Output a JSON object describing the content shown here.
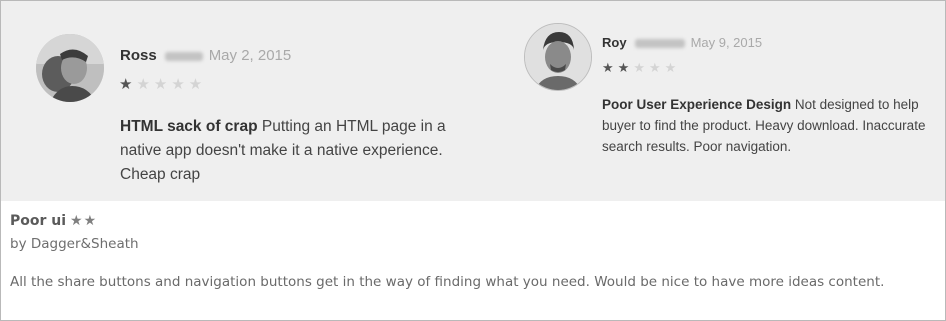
{
  "reviews": [
    {
      "author": "Ross",
      "date": "May 2, 2015",
      "rating": 1,
      "stars_filled": "★",
      "stars_empty": "★★★★",
      "title": "HTML sack of crap",
      "body": "Putting an HTML page in a native app doesn't make it a native experience. Cheap crap"
    },
    {
      "author": "Roy",
      "date": "May 9, 2015",
      "rating": 2,
      "stars_filled": "★★",
      "stars_empty": "★★★",
      "title": "Poor User Experience Design",
      "body": "Not designed to help buyer to find the product. Heavy download. Inaccurate search results. Poor navigation."
    }
  ],
  "lower_review": {
    "title": "Poor ui",
    "rating": 2,
    "stars": "★★",
    "byline": "by Dagger&Sheath",
    "body": "All the share buttons and navigation buttons get in the way of finding what you need. Would be nice to have more ideas content."
  },
  "colors": {
    "panel_background": "#efefef",
    "star_filled": "#555555",
    "star_empty": "#d4d4d4"
  }
}
